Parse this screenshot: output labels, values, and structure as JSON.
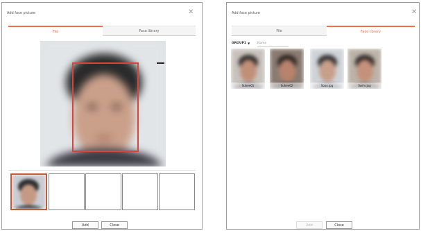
{
  "left_dialog": {
    "title": "Add face picture",
    "tabs": [
      {
        "label": "File",
        "active": true
      },
      {
        "label": "Face library",
        "active": false
      }
    ],
    "buttons": {
      "add": "Add",
      "close": "Close"
    },
    "thumbnails": [
      {
        "filled": true,
        "selected": true
      },
      {
        "filled": false
      },
      {
        "filled": false
      },
      {
        "filled": false
      },
      {
        "filled": false
      }
    ]
  },
  "right_dialog": {
    "title": "Add face picture",
    "tabs": [
      {
        "label": "File",
        "active": false
      },
      {
        "label": "Face library",
        "active": true
      }
    ],
    "group_label": "GROUP1",
    "name_placeholder": "Name",
    "library": [
      {
        "label": "Suhee01"
      },
      {
        "label": "Suhee02"
      },
      {
        "label": "Soon.jpg"
      },
      {
        "label": "Swim.jpg"
      }
    ],
    "buttons": {
      "add": "Add",
      "close": "Close"
    }
  },
  "colors": {
    "accent": "#e8704a",
    "face_frame": "#d6453a"
  },
  "icons": {
    "close": "close-icon",
    "dropdown": "chevron-down-icon"
  }
}
